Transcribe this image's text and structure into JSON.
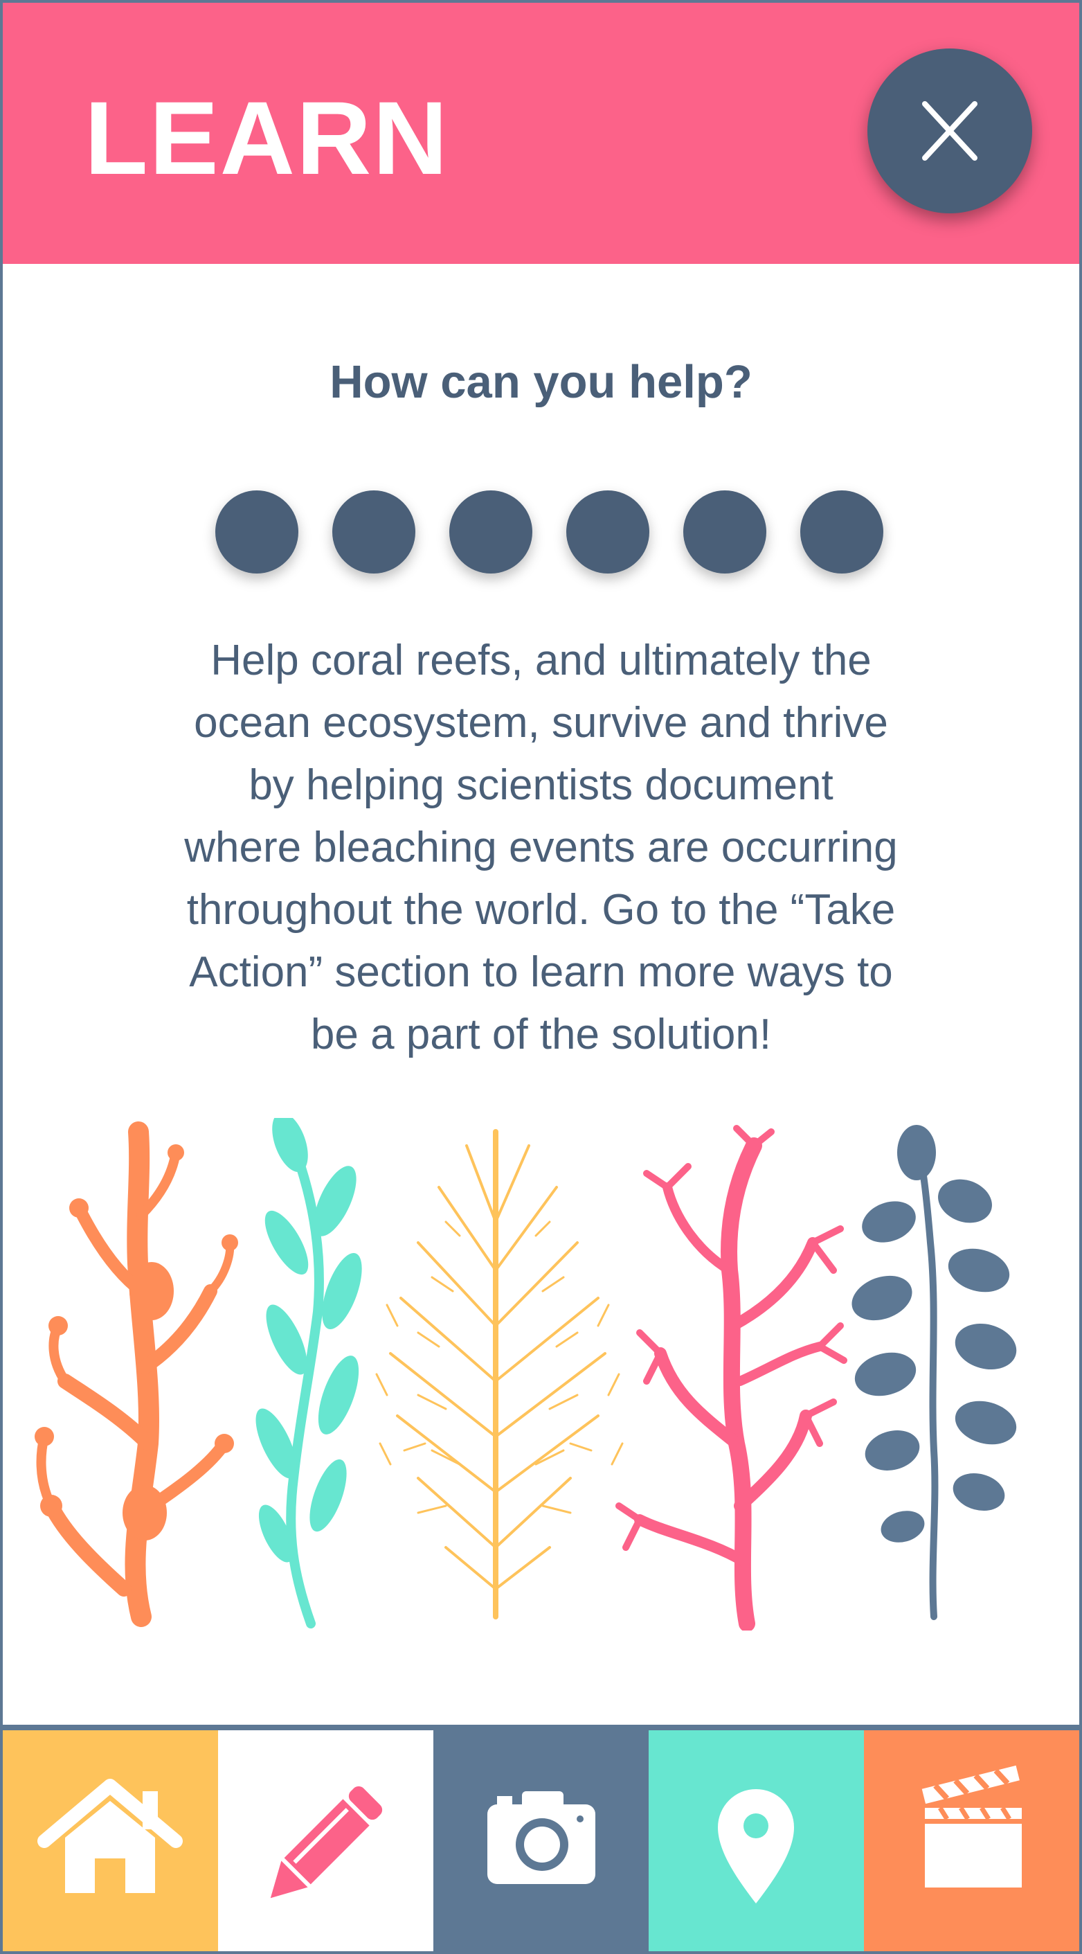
{
  "header": {
    "title": "LEARN",
    "background": "#fc6289"
  },
  "close_button": {
    "icon": "close-icon",
    "glyph": "X",
    "background": "#4a5f78"
  },
  "subtitle": "How can you help?",
  "steps": {
    "count": 6,
    "color": "#4a5f78"
  },
  "body_lines": [
    "Help coral reefs, and ultimately the",
    "ocean ecosystem, survive and thrive",
    "by helping scientists document",
    "where bleaching events are occurring",
    "throughout the world. Go to the “Take",
    "Action” section to learn more ways to",
    "be a part of the solution!"
  ],
  "illustration": {
    "plants": [
      {
        "name": "orange-coral",
        "color": "#fe8d58"
      },
      {
        "name": "teal-kelp",
        "color": "#67e6d0"
      },
      {
        "name": "yellow-sea-fan",
        "color": "#fec35b"
      },
      {
        "name": "pink-coral",
        "color": "#fc6289"
      },
      {
        "name": "slate-seaweed",
        "color": "#5d7894"
      }
    ]
  },
  "nav": [
    {
      "name": "home",
      "icon": "home-icon",
      "background": "#fec35b",
      "icon_color": "#ffffff"
    },
    {
      "name": "edit",
      "icon": "pencil-icon",
      "background": "#ffffff",
      "icon_color": "#fc6289"
    },
    {
      "name": "camera",
      "icon": "camera-icon",
      "background": "#5d7894",
      "icon_color": "#ffffff"
    },
    {
      "name": "map",
      "icon": "location-pin-icon",
      "background": "#67e6d0",
      "icon_color": "#ffffff"
    },
    {
      "name": "video",
      "icon": "clapperboard-icon",
      "background": "#fe8d58",
      "icon_color": "#ffffff"
    }
  ]
}
